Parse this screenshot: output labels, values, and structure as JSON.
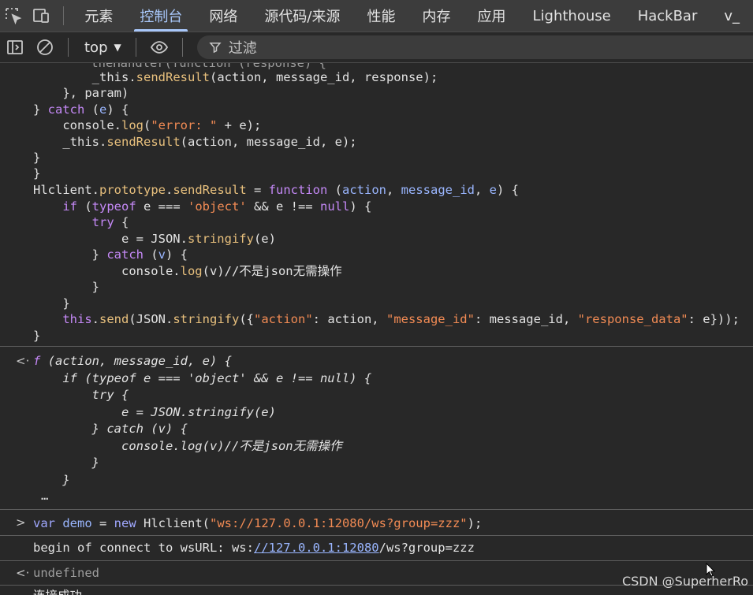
{
  "tabs": [
    "元素",
    "控制台",
    "网络",
    "源代码/来源",
    "性能",
    "内存",
    "应用",
    "Lighthouse",
    "HackBar",
    "v_"
  ],
  "toolbar": {
    "context": "top",
    "filter_placeholder": "过滤"
  },
  "console": {
    "code": [
      "    theHandler(function (response) {",
      "        _this.sendResult(action, message_id, response);",
      "    }, param)",
      "} catch (e) {",
      "    console.log(\"error: \" + e);",
      "    _this.sendResult(action, message_id, e);",
      "}",
      "}",
      "Hlclient.prototype.sendResult = function (action, message_id, e) {",
      "if (typeof e === 'object' && e !== null) {",
      "try {",
      "e = JSON.stringify(e)",
      "} catch (v) {",
      "console.log(v)//不是json无需操作",
      "}",
      "}",
      "this.send(JSON.stringify({\"action\": action, \"message_id\": message_id, \"response_data\": e}));",
      "}"
    ],
    "result_lines": [
      "f (action, message_id, e) {",
      "if (typeof e === 'object' && e !== null) {",
      "try {",
      "e = JSON.stringify(e)",
      "} catch (v) {",
      "console.log(v)//不是json无需操作",
      "}",
      "}",
      "…"
    ],
    "input_command": "var demo = new Hlclient(\"ws://127.0.0.1:12080/ws?group=zzz\");",
    "log_prefix": "begin of connect to wsURL: ws:",
    "log_link": "//127.0.0.1:12080",
    "log_suffix": "/ws?group=zzz",
    "return_value": "undefined",
    "cut_line": "连接成功"
  },
  "watermark": "CSDN @SuperherRo"
}
